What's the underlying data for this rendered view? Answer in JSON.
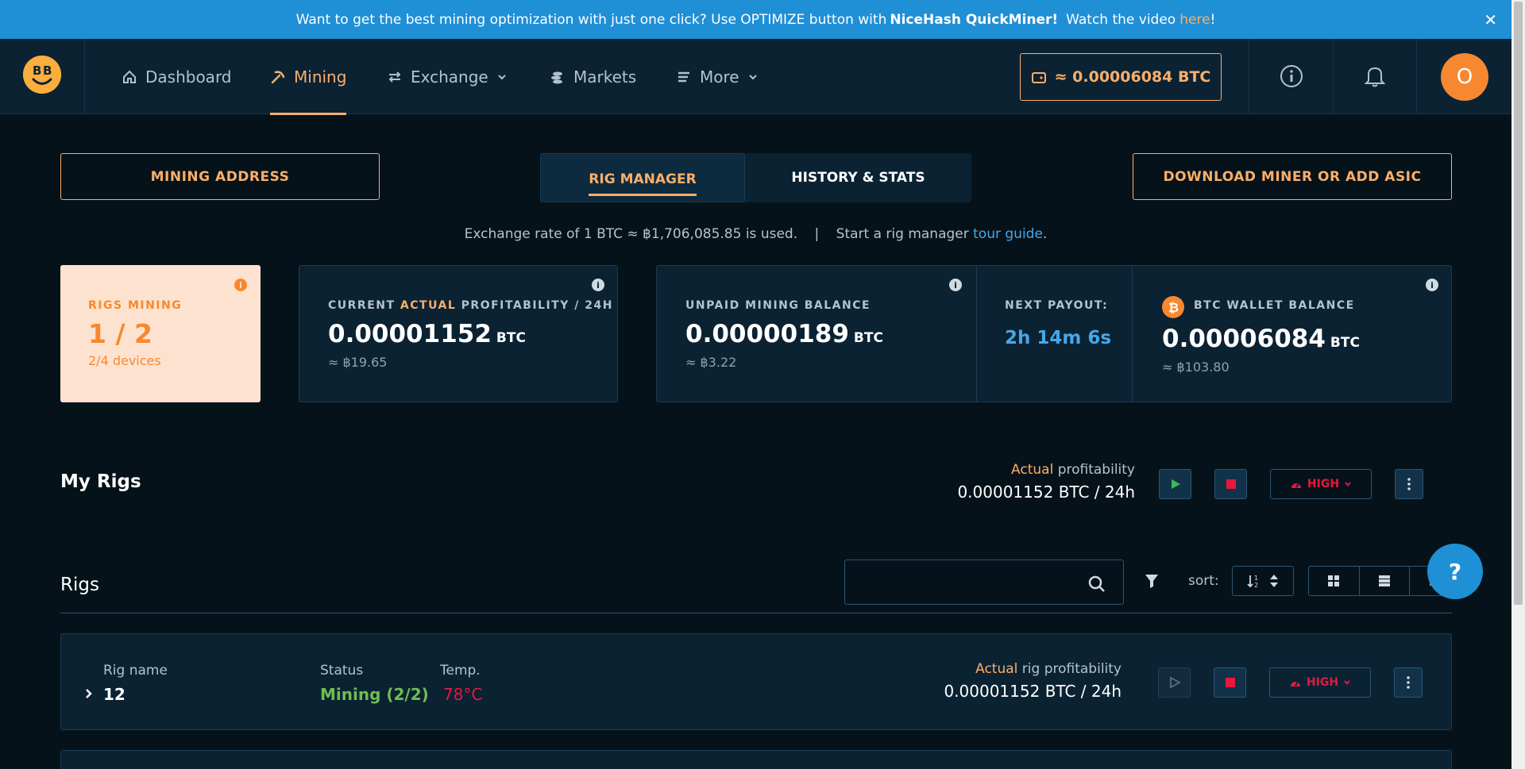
{
  "banner": {
    "text_before": "Want to get the best mining optimization with just one click? Use OPTIMIZE button with",
    "brand": "NiceHash QuickMiner!",
    "text_after": "Watch the video",
    "link": "here",
    "end": "!",
    "close": "✕"
  },
  "nav": {
    "items": [
      {
        "label": "Dashboard",
        "icon": "home-icon"
      },
      {
        "label": "Mining",
        "icon": "pickaxe-icon"
      },
      {
        "label": "Exchange",
        "icon": "exchange-icon"
      },
      {
        "label": "Markets",
        "icon": "coins-icon"
      },
      {
        "label": "More",
        "icon": "menu-icon"
      }
    ],
    "wallet_balance": "≈ 0.00006084 BTC",
    "avatar_initial": "O"
  },
  "actions": {
    "mining_address": "MINING ADDRESS",
    "download": "DOWNLOAD MINER OR ADD ASIC"
  },
  "tabs": [
    "RIG MANAGER",
    "HISTORY & STATS"
  ],
  "rate": {
    "text": "Exchange rate of 1 BTC ≈ ฿1,706,085.85 is used.",
    "sep": "|",
    "tour_text": "Start a rig manager",
    "tour_link": "tour guide",
    "tour_end": "."
  },
  "stats": {
    "rigs_mining": {
      "label": "RIGS MINING",
      "value": "1 / 2",
      "devices": "2/4 devices"
    },
    "profitability": {
      "label_pre": "CURRENT",
      "label_hl": "ACTUAL",
      "label_post": "PROFITABILITY / 24H",
      "value": "0.00001152",
      "unit": "BTC",
      "fiat": "≈ ฿19.65"
    },
    "unpaid": {
      "label": "UNPAID MINING BALANCE",
      "value": "0.00000189",
      "unit": "BTC",
      "fiat": "≈ ฿3.22"
    },
    "payout": {
      "label": "NEXT PAYOUT:",
      "value": "2h 14m 6s"
    },
    "wallet": {
      "label": "BTC WALLET BALANCE",
      "value": "0.00006084",
      "unit": "BTC",
      "fiat": "≈ ฿103.80"
    }
  },
  "my_rigs": {
    "title": "My Rigs",
    "actual": "Actual",
    "profit_label": "profitability",
    "profit_value": "0.00001152 BTC / 24h",
    "power_mode": "HIGH"
  },
  "rigs_list": {
    "title": "Rigs",
    "sort_label": "sort:",
    "rig": {
      "name_label": "Rig name",
      "name": "12",
      "status_label": "Status",
      "status": "Mining (2/2)",
      "temp_label": "Temp.",
      "temp": "78°C",
      "actual": "Actual",
      "profit_label": "rig profitability",
      "profit_value": "0.00001152 BTC / 24h",
      "power_mode": "HIGH"
    }
  },
  "help": "?"
}
